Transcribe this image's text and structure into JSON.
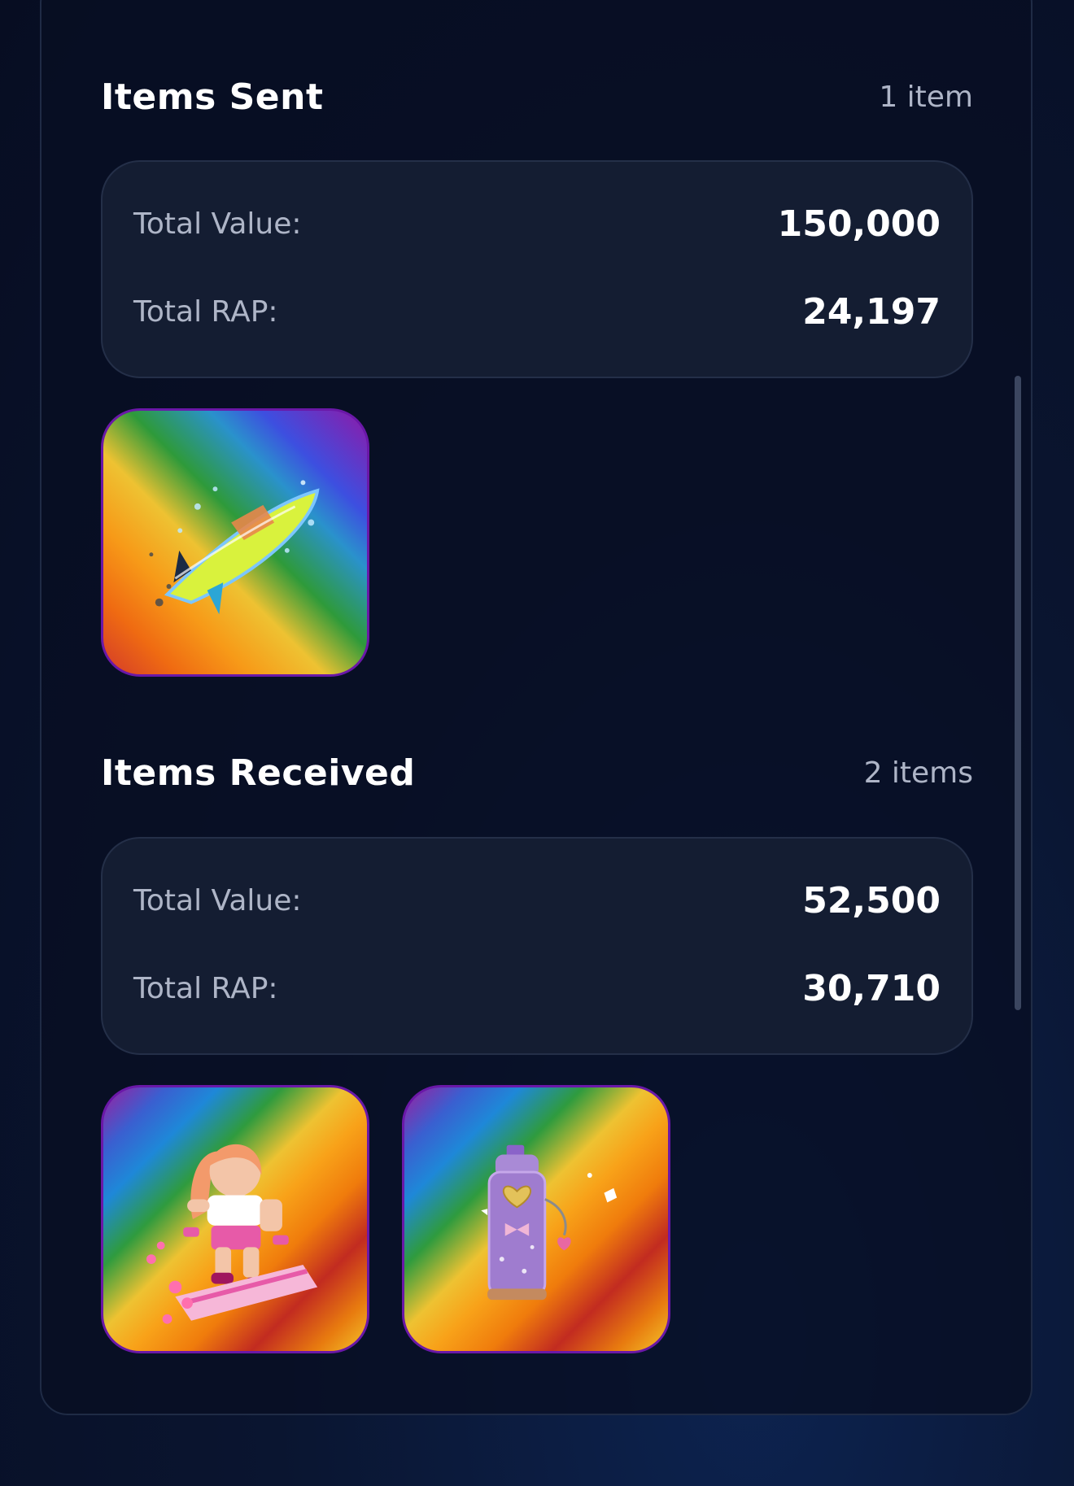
{
  "sent": {
    "title": "Items Sent",
    "count": "1 item",
    "total_value_label": "Total Value:",
    "total_value": "150,000",
    "total_rap_label": "Total RAP:",
    "total_rap": "24,197",
    "items": [
      {
        "icon": "surfboard-splash-icon"
      }
    ]
  },
  "received": {
    "title": "Items Received",
    "count": "2 items",
    "total_value_label": "Total Value:",
    "total_value": "52,500",
    "total_rap_label": "Total RAP:",
    "total_rap": "30,710",
    "items": [
      {
        "icon": "hoverboard-girl-icon"
      },
      {
        "icon": "spray-can-icon"
      }
    ]
  },
  "colors": {
    "background": "#070d22",
    "panel_border": "#1f2b45",
    "summary_bg": "#141d32",
    "tile_border": "#6a18a8",
    "label_text": "#aeb5c7",
    "value_text": "#ffffff"
  }
}
